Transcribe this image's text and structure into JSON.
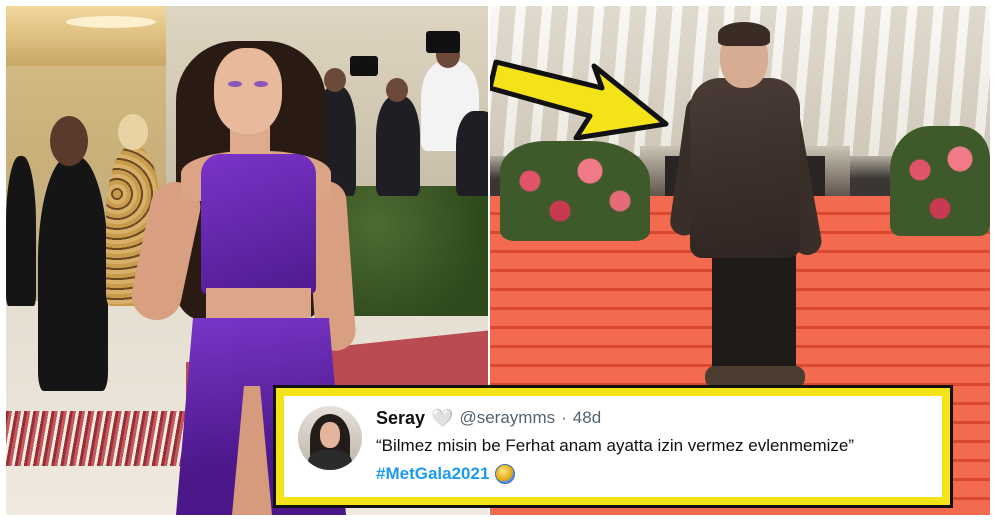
{
  "tweet": {
    "display_name": "Seray",
    "heart_glyph": "🤍",
    "handle": "@seraymms",
    "separator": "·",
    "time": "48d",
    "text": "“Bilmez misin be Ferhat anam ayatta izin vermez evlenmemize”",
    "hashtag": "#MetGala2021"
  },
  "icons": {
    "avatar": "profile-avatar",
    "hashtag_emoji": "disco-ball-icon",
    "pointer": "yellow-arrow-icon"
  },
  "colors": {
    "highlight_border": "#f5e31a",
    "hashtag": "#1d9bf0",
    "arrow": "#f5e31a"
  }
}
